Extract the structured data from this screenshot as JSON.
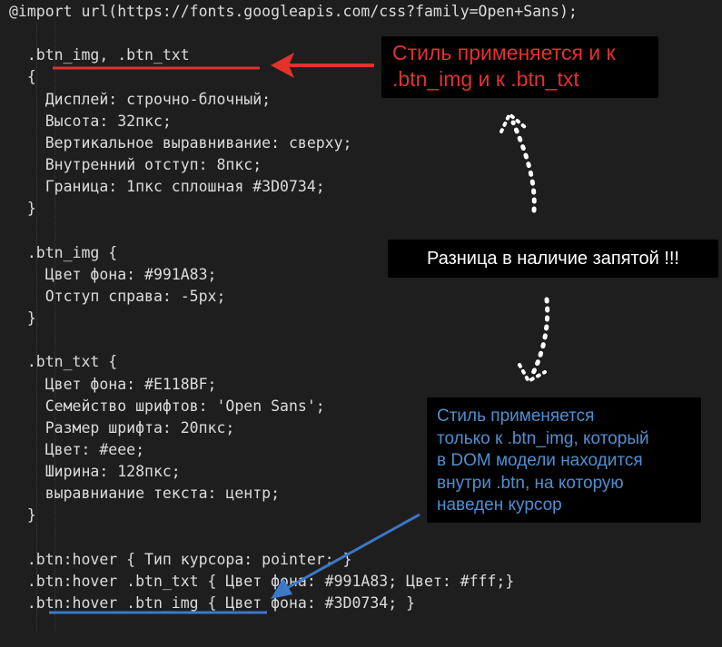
{
  "code": {
    "lines": [
      "@import url(https://fonts.googleapis.com/css?family=Open+Sans);",
      "",
      "  .btn_img, .btn_txt",
      "  {",
      "    Дисплей: строчно-блочный;",
      "    Высота: 32пкс;",
      "    Вертикальное выравнивание: сверху;",
      "    Внутренний отступ: 8пкс;",
      "    Граница: 1пкс сплошная #3D0734;",
      "  }",
      "",
      "  .btn_img {",
      "    Цвет фона: #991A83;",
      "    Отступ справа: -5px;",
      "  }",
      "",
      "  .btn_txt {",
      "    Цвет фона: #E118BF;",
      "    Семейство шрифтов: 'Open Sans';",
      "    Размер шрифта: 20пкс;",
      "    Цвет: #eee;",
      "    Ширина: 128пкс;",
      "    выравниание текста: центр;",
      "  }",
      "",
      "  .btn:hover { Тип курсора: pointer; }",
      "  .btn:hover .btn_txt { Цвет фона: #991A83; Цвет: #fff;}",
      "  .btn:hover .btn_img { Цвет фона: #3D0734; }"
    ]
  },
  "callouts": {
    "red": {
      "lines": [
        "Стиль применяется и к",
        ".btn_img и к .btn_txt"
      ],
      "color": "#e2322b"
    },
    "white": {
      "text": "Разница в наличие запятой !!!",
      "color": "#ffffff"
    },
    "blue": {
      "lines": [
        "Стиль применяется",
        "только к .btn_img, который",
        "в DOM модели находится",
        "внутри .btn, на которую",
        "наведен курсор"
      ],
      "color": "#4f8fd1"
    }
  },
  "colors": {
    "background": "#1e1e1e",
    "code_text": "#dcdcdc",
    "red_accent": "#e2322b",
    "blue_accent": "#3c78c8",
    "dotted_arrow": "#ffffff"
  }
}
